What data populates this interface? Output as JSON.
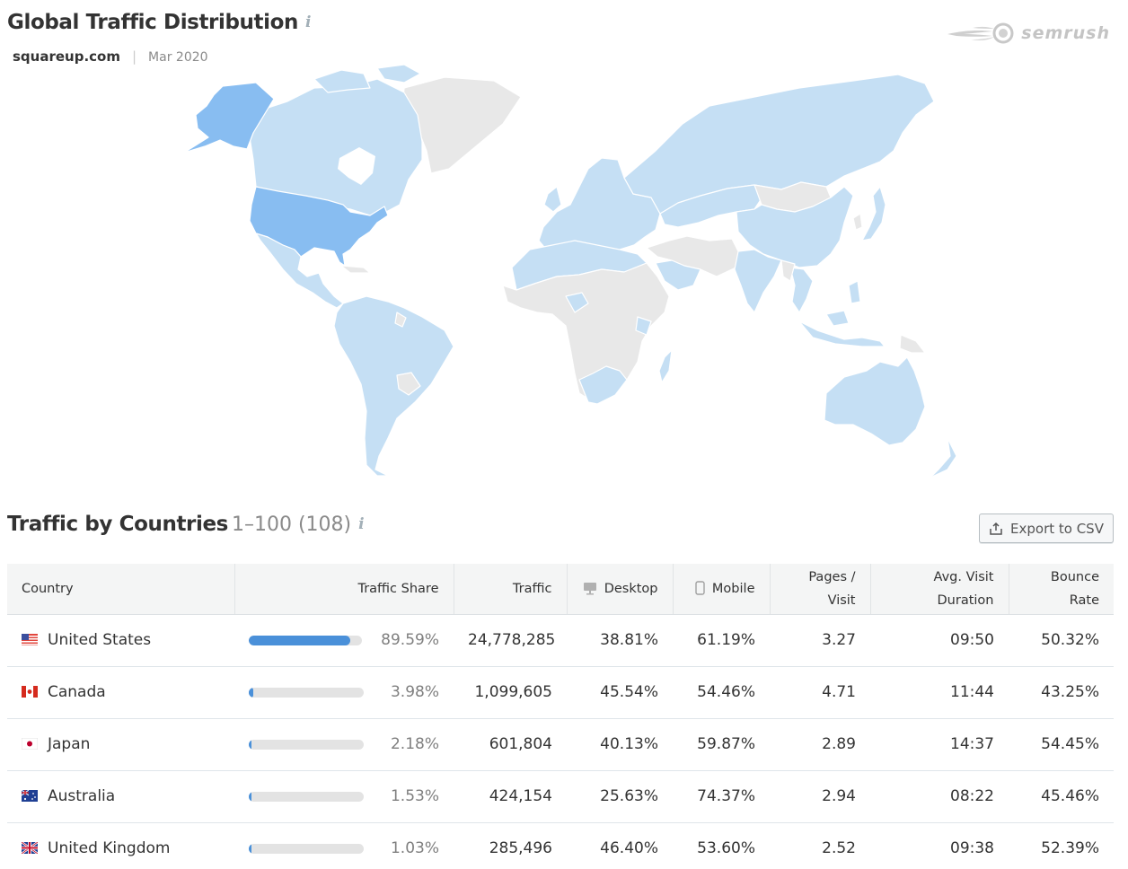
{
  "header": {
    "title": "Global Traffic Distribution",
    "info_icon": "i",
    "domain": "squareup.com",
    "separator": "|",
    "date": "Mar 2020"
  },
  "brand": {
    "logo_text": "semrush",
    "logo_icon": "semrush-fireball-icon"
  },
  "map": {
    "colors": {
      "top": "#88bdf1",
      "active": "#c5dff4",
      "inactive": "#e8e8e8"
    },
    "highlighted_top": [
      "United States"
    ],
    "with_traffic_regions": [
      "Canada",
      "Mexico",
      "Central America",
      "South America",
      "Europe",
      "Russia",
      "China",
      "India",
      "Japan",
      "Southeast Asia",
      "Australia",
      "New Zealand",
      "North Africa",
      "Southern Africa"
    ],
    "no_data_regions": [
      "Greenland",
      "Mongolia",
      "Central Africa",
      "Middle East",
      "Central Asia",
      "Papua New Guinea"
    ]
  },
  "section": {
    "title": "Traffic by Countries",
    "range": "1–100 (108)",
    "info_icon": "i",
    "export_label": "Export to CSV"
  },
  "table": {
    "columns": {
      "country": "Country",
      "share": "Traffic Share",
      "traffic": "Traffic",
      "desktop": "Desktop",
      "mobile": "Mobile",
      "pages_l1": "Pages /",
      "pages_l2": "Visit",
      "duration_l1": "Avg. Visit",
      "duration_l2": "Duration",
      "bounce_l1": "Bounce",
      "bounce_l2": "Rate"
    },
    "rows": [
      {
        "flag": "us",
        "country": "United States",
        "share_value": 89.59,
        "share": "89.59%",
        "traffic": "24,778,285",
        "desktop": "38.81%",
        "mobile": "61.19%",
        "pages": "3.27",
        "duration": "09:50",
        "bounce": "50.32%"
      },
      {
        "flag": "ca",
        "country": "Canada",
        "share_value": 3.98,
        "share": "3.98%",
        "traffic": "1,099,605",
        "desktop": "45.54%",
        "mobile": "54.46%",
        "pages": "4.71",
        "duration": "11:44",
        "bounce": "43.25%"
      },
      {
        "flag": "jp",
        "country": "Japan",
        "share_value": 2.18,
        "share": "2.18%",
        "traffic": "601,804",
        "desktop": "40.13%",
        "mobile": "59.87%",
        "pages": "2.89",
        "duration": "14:37",
        "bounce": "54.45%"
      },
      {
        "flag": "au",
        "country": "Australia",
        "share_value": 1.53,
        "share": "1.53%",
        "traffic": "424,154",
        "desktop": "25.63%",
        "mobile": "74.37%",
        "pages": "2.94",
        "duration": "08:22",
        "bounce": "45.46%"
      },
      {
        "flag": "gb",
        "country": "United Kingdom",
        "share_value": 1.03,
        "share": "1.03%",
        "traffic": "285,496",
        "desktop": "46.40%",
        "mobile": "53.60%",
        "pages": "2.52",
        "duration": "09:38",
        "bounce": "52.39%"
      }
    ]
  }
}
